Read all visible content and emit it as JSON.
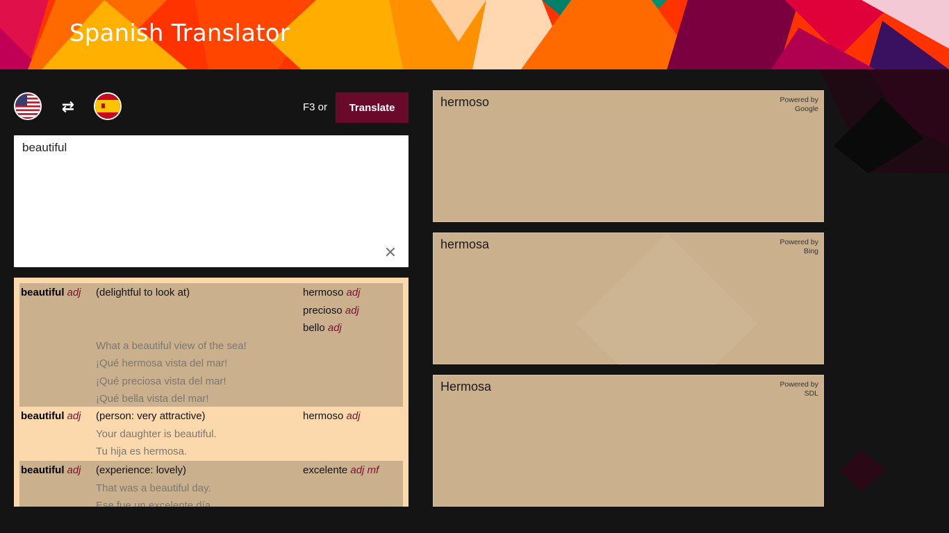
{
  "app": {
    "title": "Spanish Translator"
  },
  "toolbar": {
    "source_flag": "us-flag-icon",
    "target_flag": "spain-flag-icon",
    "swap_icon": "swap-arrows-icon",
    "shortcut_hint": "F3 or",
    "translate_label": "Translate",
    "accent_color": "#6a0a2a"
  },
  "input": {
    "value": "beautiful",
    "clear_icon": "clear-icon"
  },
  "dictionary": {
    "entries": [
      {
        "term": "beautiful",
        "pos": "adj",
        "sense": "(delightful to look at)",
        "translations": [
          {
            "word": "hermoso",
            "pos": "adj"
          },
          {
            "word": "precioso",
            "pos": "adj"
          },
          {
            "word": "bello",
            "pos": "adj"
          }
        ],
        "examples": [
          "What a beautiful view of the sea!",
          "¡Qué hermosa vista del mar!",
          "¡Qué preciosa vista del mar!",
          "¡Qué bella vista del mar!"
        ]
      },
      {
        "term": "beautiful",
        "pos": "adj",
        "sense": "(person: very attractive)",
        "translations": [
          {
            "word": "hermoso",
            "pos": "adj"
          }
        ],
        "examples": [
          "Your daughter is beautiful.",
          "Tu hija es hermosa."
        ]
      },
      {
        "term": "beautiful",
        "pos": "adj",
        "sense": "(experience: lovely)",
        "translations": [
          {
            "word": "excelente",
            "pos": "adj mf"
          }
        ],
        "examples": [
          "That was a beautiful day.",
          "Ese fue un excelente día."
        ]
      }
    ]
  },
  "results": [
    {
      "text": "hermoso",
      "powered_by": "Powered by",
      "provider": "Google"
    },
    {
      "text": "hermosa",
      "powered_by": "Powered by",
      "provider": "Bing"
    },
    {
      "text": "Hermosa",
      "powered_by": "Powered by",
      "provider": "SDL"
    }
  ]
}
